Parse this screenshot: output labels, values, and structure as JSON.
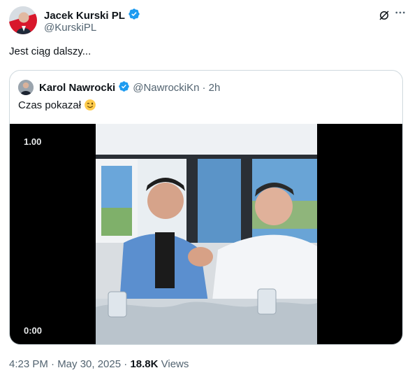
{
  "post": {
    "author_name": "Jacek Kurski PL",
    "author_handle": "@KurskiPL",
    "text": "Jest ciąg dalszy...",
    "timestamp": "4:23 PM · May 30, 2025",
    "separator": " · ",
    "views_count": "18.8K",
    "views_label": " Views"
  },
  "quoted": {
    "author_name": "Karol Nawrocki",
    "author_handle": "@NawrockiKn",
    "age": "· 2h",
    "text": "Czas pokazał"
  },
  "video": {
    "speed": "1.00",
    "time": "0:00"
  },
  "icons": {
    "verified": "verified-badge-icon",
    "grok": "grok-icon",
    "more": "more-icon",
    "emoji": "wink-emoji-icon"
  },
  "colors": {
    "verified_blue": "#1d9bf0",
    "text_secondary": "#536471"
  }
}
